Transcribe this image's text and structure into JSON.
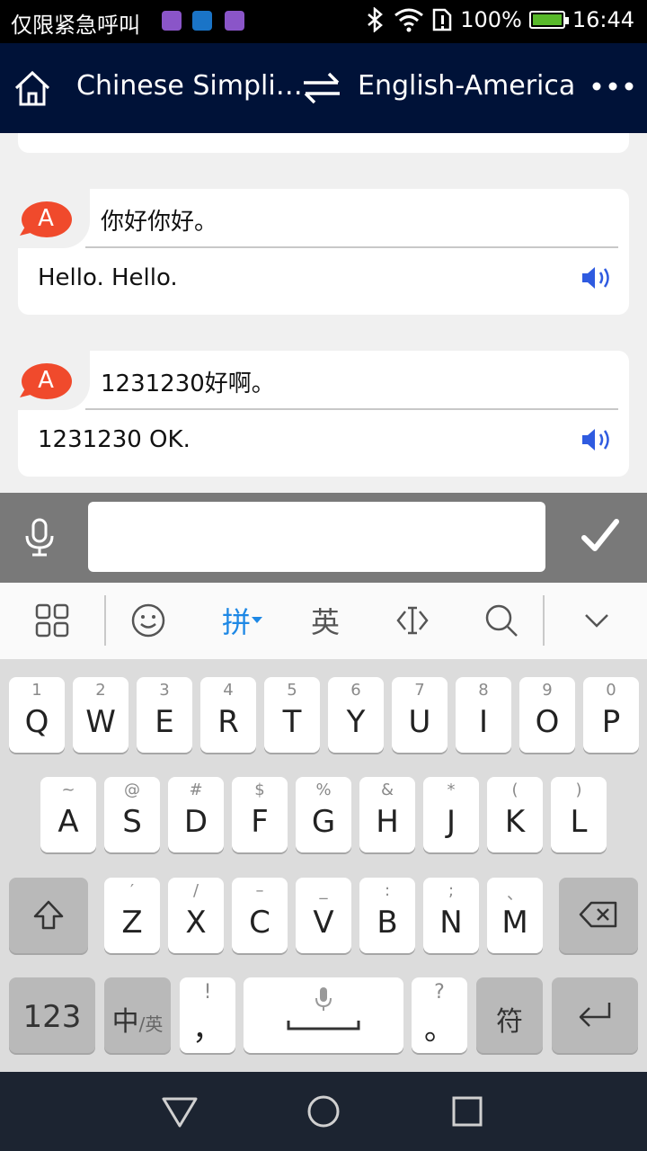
{
  "status_bar": {
    "carrier": "仅限紧急呼叫",
    "battery": "100%",
    "time": "16:44",
    "icons": [
      "bluetooth-icon",
      "wifi-icon",
      "sim-alert-icon",
      "battery-icon"
    ]
  },
  "header": {
    "source_language": "Chinese Simpli…",
    "target_language": "English-America",
    "icons": [
      "home-icon",
      "swap-icon",
      "more-icon"
    ]
  },
  "conversation": [
    {
      "avatar": "A",
      "source": "你好你好。",
      "translation": "Hello. Hello."
    },
    {
      "avatar": "A",
      "source": "1231230好啊。",
      "translation": "1231230 OK."
    }
  ],
  "input": {
    "value": "",
    "placeholder": ""
  },
  "ime_toolbar": {
    "pinyin": "拼",
    "english": "英"
  },
  "keyboard": {
    "row1": [
      {
        "hint": "1",
        "key": "Q"
      },
      {
        "hint": "2",
        "key": "W"
      },
      {
        "hint": "3",
        "key": "E"
      },
      {
        "hint": "4",
        "key": "R"
      },
      {
        "hint": "5",
        "key": "T"
      },
      {
        "hint": "6",
        "key": "Y"
      },
      {
        "hint": "7",
        "key": "U"
      },
      {
        "hint": "8",
        "key": "I"
      },
      {
        "hint": "9",
        "key": "O"
      },
      {
        "hint": "0",
        "key": "P"
      }
    ],
    "row2": [
      {
        "hint": "~",
        "key": "A"
      },
      {
        "hint": "@",
        "key": "S"
      },
      {
        "hint": "#",
        "key": "D"
      },
      {
        "hint": "$",
        "key": "F"
      },
      {
        "hint": "%",
        "key": "G"
      },
      {
        "hint": "&",
        "key": "H"
      },
      {
        "hint": "*",
        "key": "J"
      },
      {
        "hint": "(",
        "key": "K"
      },
      {
        "hint": ")",
        "key": "L"
      }
    ],
    "row3": [
      {
        "hint": "′",
        "key": "Z"
      },
      {
        "hint": "/",
        "key": "X"
      },
      {
        "hint": "–",
        "key": "C"
      },
      {
        "hint": "_",
        "key": "V"
      },
      {
        "hint": ":",
        "key": "B"
      },
      {
        "hint": ";",
        "key": "N"
      },
      {
        "hint": "、",
        "key": "M"
      }
    ],
    "num_label": "123",
    "lang_zh": "中",
    "lang_en": "/英",
    "comma_hint": "!",
    "comma": "，",
    "period_hint": "?",
    "period": "。",
    "symbol": "符"
  }
}
